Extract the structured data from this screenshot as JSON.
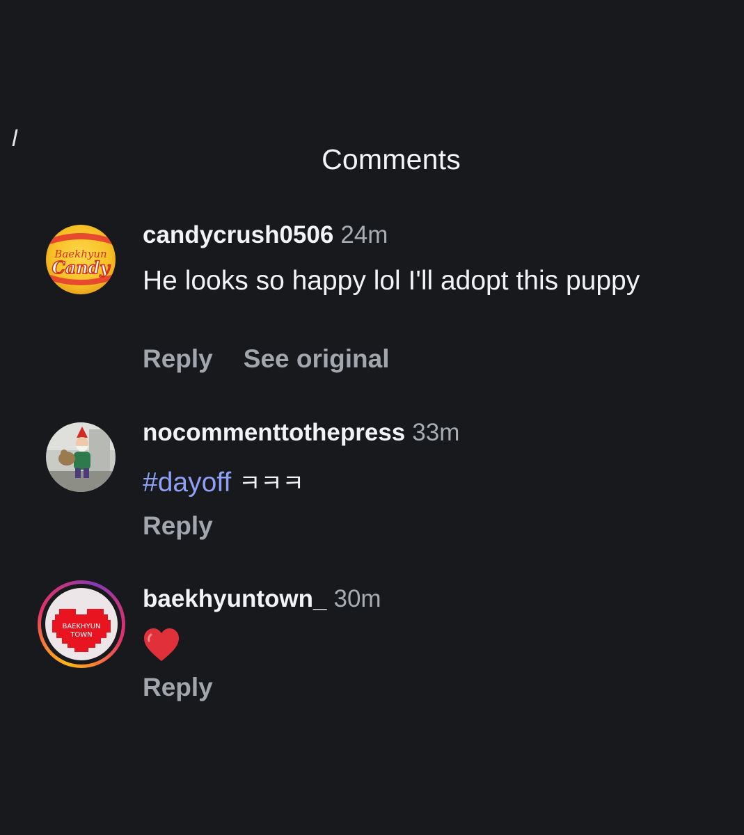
{
  "sheet": {
    "title": "Comments"
  },
  "comments": [
    {
      "username": "candycrush0506",
      "time": "24m",
      "text": "He looks so happy lol I'll adopt this puppy",
      "avatar": {
        "line1": "Baekhyun",
        "line2": "Candy"
      },
      "actions": {
        "reply": "Reply",
        "see_original": "See original"
      }
    },
    {
      "username": "nocommenttothepress",
      "time": "33m",
      "hashtag": "#dayoff",
      "text_suffix": "ㅋㅋㅋ",
      "actions": {
        "reply": "Reply"
      }
    },
    {
      "username": "baekhyuntown_",
      "time": "30m",
      "text": "❤️",
      "avatar": {
        "line1": "BAEKHYUN",
        "line2": "TOWN"
      },
      "actions": {
        "reply": "Reply"
      }
    }
  ],
  "colors": {
    "background": "#17191c",
    "text": "#f2f3f5",
    "muted": "#a8acb3",
    "hashtag": "#8ea1f6",
    "heart": "#e0303a"
  }
}
